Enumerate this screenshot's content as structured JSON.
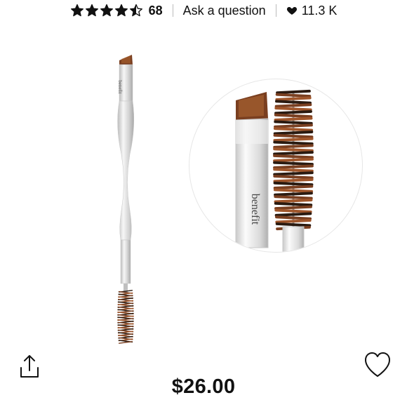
{
  "rating": {
    "value": 4.5,
    "max": 5,
    "count": "68"
  },
  "ask_question": "Ask a question",
  "loves": "11.3 K",
  "product": {
    "brand": "benefit",
    "price": "$26.00"
  },
  "icons": {
    "share": "share-icon",
    "heart": "heart-outline-icon",
    "star": "star-icon",
    "loves": "heart-filled-icon"
  },
  "colors": {
    "text": "#111111",
    "bristle": "#7a3f20",
    "handle": "#d6d6d6"
  }
}
